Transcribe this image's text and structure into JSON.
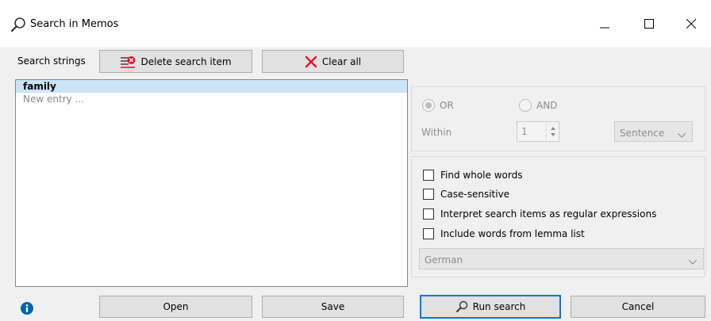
{
  "window": {
    "title": "Search in Memos"
  },
  "toolbar": {
    "search_strings_label": "Search strings",
    "delete_label": "Delete search item",
    "clear_label": "Clear all"
  },
  "list": {
    "items": [
      "family"
    ],
    "new_entry_placeholder": "New entry ..."
  },
  "logic": {
    "or_label": "OR",
    "and_label": "AND",
    "selected": "OR",
    "within_label": "Within",
    "within_value": "1",
    "unit_value": "Sentence"
  },
  "options": {
    "find_whole_words": "Find whole words",
    "case_sensitive": "Case-sensitive",
    "regex": "Interpret search items as regular expressions",
    "lemma": "Include words from lemma list",
    "language": "German"
  },
  "footer": {
    "open_label": "Open",
    "save_label": "Save",
    "run_label": "Run search",
    "cancel_label": "Cancel"
  },
  "colors": {
    "accent": "#0078d7",
    "selection": "#cce4f7",
    "delete_red": "#e81123",
    "info_blue": "#0063b1"
  }
}
